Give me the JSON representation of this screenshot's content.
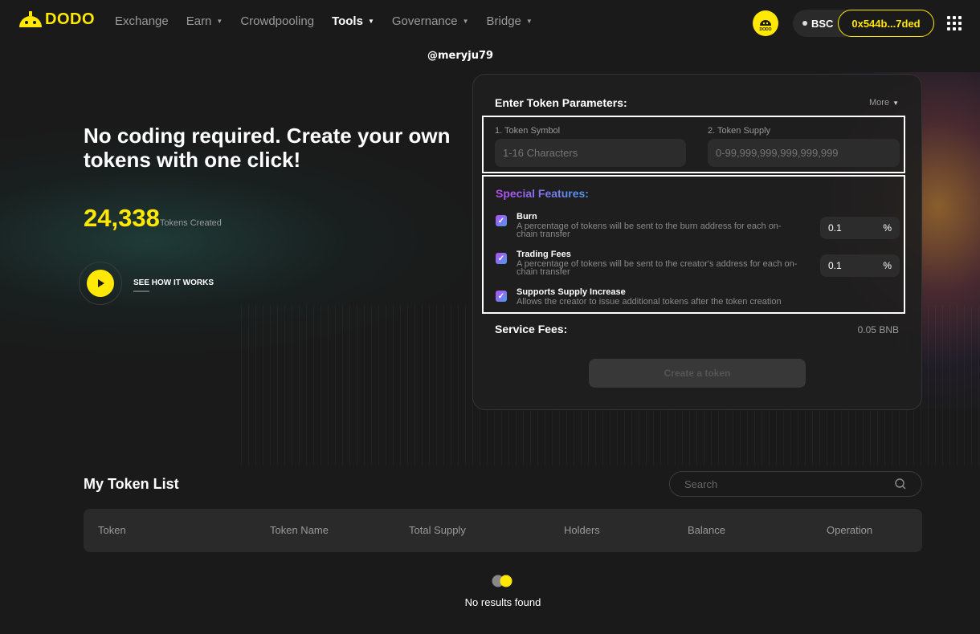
{
  "brand": {
    "name": "DODO",
    "color": "#ffe804"
  },
  "nav": [
    {
      "label": "Exchange",
      "dropdown": false,
      "active": false
    },
    {
      "label": "Earn",
      "dropdown": true,
      "active": false
    },
    {
      "label": "Crowdpooling",
      "dropdown": false,
      "active": false
    },
    {
      "label": "Tools",
      "dropdown": true,
      "active": true
    },
    {
      "label": "Governance",
      "dropdown": true,
      "active": false
    },
    {
      "label": "Bridge",
      "dropdown": true,
      "active": false
    }
  ],
  "wallet": {
    "network": "BSC",
    "address": "0x544b...7ded",
    "avatar_text": "DODO"
  },
  "watermark": "@meryju79",
  "hero": {
    "title": "No coding required. Create your own tokens with one click!",
    "stat_value": "24,338",
    "stat_label": "Tokens Created",
    "video_link": "SEE HOW IT WORKS"
  },
  "form": {
    "title": "Enter Token Parameters:",
    "more_label": "More",
    "symbol_label": "1. Token Symbol",
    "symbol_placeholder": "1-16 Characters",
    "supply_label": "2. Token Supply",
    "supply_placeholder": "0-99,999,999,999,999,999",
    "special_title": "Special Features:",
    "features": [
      {
        "name": "Burn",
        "desc": "A percentage of tokens will be sent to the burn address for each on-chain transfer",
        "checked": true,
        "value": "0.1",
        "unit": "%"
      },
      {
        "name": "Trading Fees",
        "desc": "A percentage of tokens will be sent to the creator's address for each on-chain transfer",
        "checked": true,
        "value": "0.1",
        "unit": "%"
      },
      {
        "name": "Supports Supply Increase",
        "desc": "Allows the creator to issue additional tokens after the token creation",
        "checked": true
      }
    ],
    "service_label": "Service Fees:",
    "service_value": "0.05 BNB",
    "create_label": "Create a token"
  },
  "token_list": {
    "title": "My Token List",
    "search_placeholder": "Search",
    "columns": [
      "Token",
      "Token Name",
      "Total Supply",
      "Holders",
      "Balance",
      "Operation"
    ],
    "empty_text": "No results found"
  }
}
